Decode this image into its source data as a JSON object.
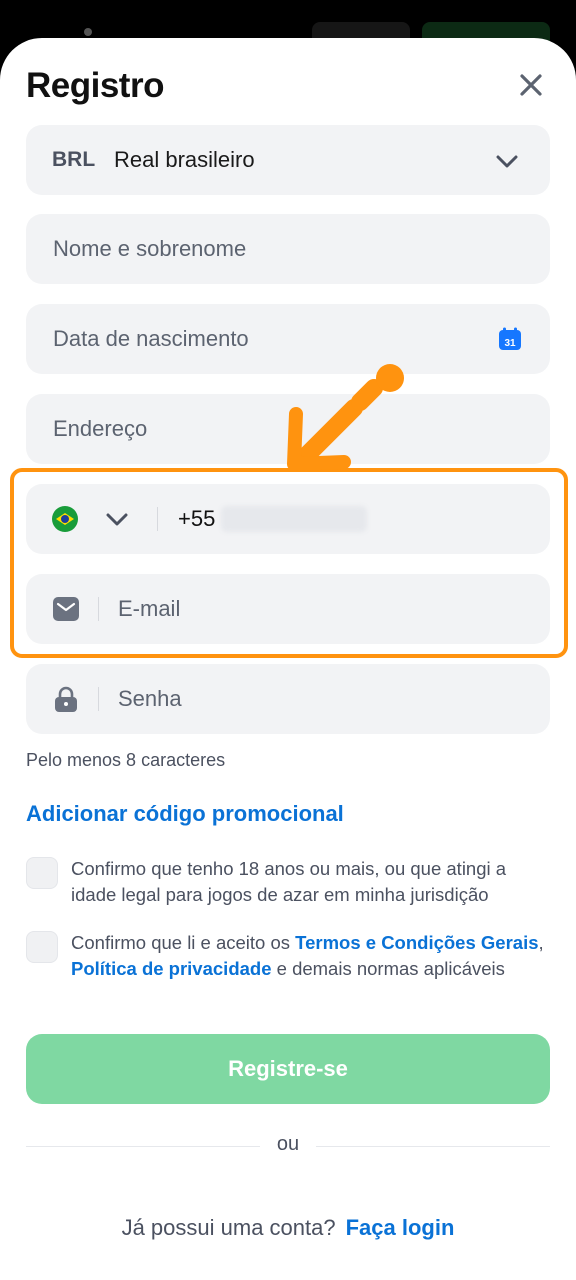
{
  "modal": {
    "title": "Registro"
  },
  "currency": {
    "code": "BRL",
    "name": "Real brasileiro"
  },
  "fields": {
    "name_placeholder": "Nome e sobrenome",
    "dob_placeholder": "Data de nascimento",
    "calendar_day": "31",
    "address_placeholder": "Endereço",
    "phone_prefix": "+55",
    "email_placeholder": "E-mail",
    "password_placeholder": "Senha"
  },
  "password_hint": "Pelo menos 8 caracteres",
  "promo_link": "Adicionar código promocional",
  "consent": {
    "age_text": "Confirmo que tenho 18 anos ou mais, ou que atingi a idade legal para jogos de azar em minha jurisdição",
    "terms_prefix": "Confirmo que li e aceito os ",
    "terms_link": "Termos e Condições Gerais",
    "terms_sep": ", ",
    "privacy_link": "Política de privacidade",
    "terms_suffix": " e demais normas aplicáveis"
  },
  "submit_label": "Registre-se",
  "or_label": "ou",
  "footer": {
    "question": "Já possui uma conta?",
    "login_label": "Faça login"
  },
  "colors": {
    "accent_blue": "#0a72d6",
    "submit_green": "#7fd8a2",
    "highlight_orange": "#ff930f"
  }
}
